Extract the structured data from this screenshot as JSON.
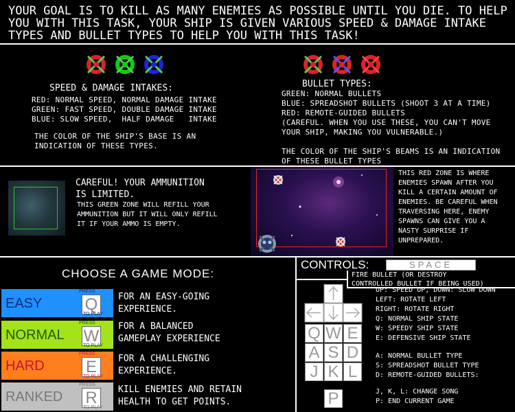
{
  "intro": {
    "line1": "YOUR GOAL IS TO KILL AS MANY ENEMIES AS POSSIBLE UNTIL YOU DIE. TO HELP",
    "line2": "YOU WITH THIS TASK, YOUR SHIP IS GIVEN VARIOUS SPEED & DAMAGE INTAKE",
    "line3": "TYPES AND BULLET TYPES TO HELP YOU WITH THIS TASK!"
  },
  "speed": {
    "heading": "SPEED & DAMAGE INTAKES:",
    "red": "RED: NORMAL SPEED, NORMAL DAMAGE INTAKE",
    "green": "GREEN: FAST SPEED, DOUBLE DAMAGE INTAKE",
    "blue": "BLUE: SLOW SPEED,  HALF DAMAGE   INTAKE",
    "note1": "THE COLOR OF THE SHIP'S BASE IS AN",
    "note2": "INDICATION OF THESE TYPES."
  },
  "bullets": {
    "heading": "BULLET TYPES:",
    "green": "GREEN: NORMAL BULLETS",
    "blue": "BLUE: SPREADSHOT BULLETS (SHOOT 3 AT A TIME)",
    "red": "RED: REMOTE-GUIDED BULLETS",
    "warn1": "(CAREFUL. WHEN YOU USE THESE, YOU CAN'T MOVE",
    "warn2": "YOUR SHIP, MAKING YOU VULNERABLE.)",
    "note1": "THE COLOR OF THE SHIP'S BEAMS IS AN INDICATION",
    "note2": "OF THESE BULLET TYPES"
  },
  "ammo": {
    "title1": "CAREFUL! YOUR AMMUNITION",
    "title2": "IS LIMITED.",
    "line1": "THIS GREEN ZONE WILL REFILL YOUR",
    "line2": "AMMUNITION BUT IT WILL ONLY REFILL",
    "line3": "IT IF YOUR AMMO IS EMPTY."
  },
  "redzone": {
    "line1": "THIS RED ZONE IS WHERE",
    "line2": "ENEMIES SPAWN AFTER YOU",
    "line3": "KILL A CERTAIN AMOUNT OF",
    "line4": "ENEMIES. BE CAREFUL WHEN",
    "line5": "TRAVERSING HERE, ENEMY",
    "line6": "SPAWNS CAN GIVE YOU A",
    "line7": "NASTY SURPRISE IF",
    "line8": "UNPREPARED."
  },
  "modes": {
    "heading": "CHOOSE A GAME MODE:",
    "press": "PRESS",
    "toplay": "TO PLAY",
    "items": [
      {
        "label": "EASY",
        "key": "Q",
        "desc1": "FOR AN EASY-GOING",
        "desc2": "EXPERIENCE."
      },
      {
        "label": "NORMAL",
        "key": "W",
        "desc1": "FOR A BALANCED",
        "desc2": "GAMEPLAY EXPERIENCE"
      },
      {
        "label": "HARD",
        "key": "E",
        "desc1": "FOR A CHALLENGING",
        "desc2": "EXPERIENCE."
      },
      {
        "label": "RANKED",
        "key": "R",
        "desc1": "KILL ENEMIES AND RETAIN",
        "desc2": "HEALTH TO GET POINTS."
      }
    ]
  },
  "controls": {
    "heading": "CONTROLS:",
    "space_key": "SPACE",
    "space1": "FIRE BULLET (OR DESTROY",
    "space2": "CONTROLLED BULLET IF BEING USED)",
    "arrows1": "UP: SPEED UP, DOWN: SLOW DOWN",
    "arrows2": "LEFT: ROTATE LEFT",
    "arrows3": "RIGHT: ROTATE RIGHT",
    "q": "Q: NORMAL SHIP STATE",
    "w": "W: SPEEDY SHIP STATE",
    "e": "E: DEFENSIVE SHIP STATE",
    "a": "A: NORMAL BULLET TYPE",
    "s": "S: SPREADSHOT BULLET TYPE",
    "d": "D: REMOTE-GUIDED BULLETS:",
    "jkl": "J, K, L: CHANGE SONG",
    "p": "P: END CURRENT GAME",
    "keys": [
      "Q",
      "W",
      "E",
      "A",
      "S",
      "D",
      "J",
      "K",
      "L",
      "P"
    ]
  },
  "colors": {
    "easy": "#1e90ff",
    "normal": "#a4e21a",
    "hard": "#ff7f1e",
    "ranked": "#c0c0c0"
  }
}
